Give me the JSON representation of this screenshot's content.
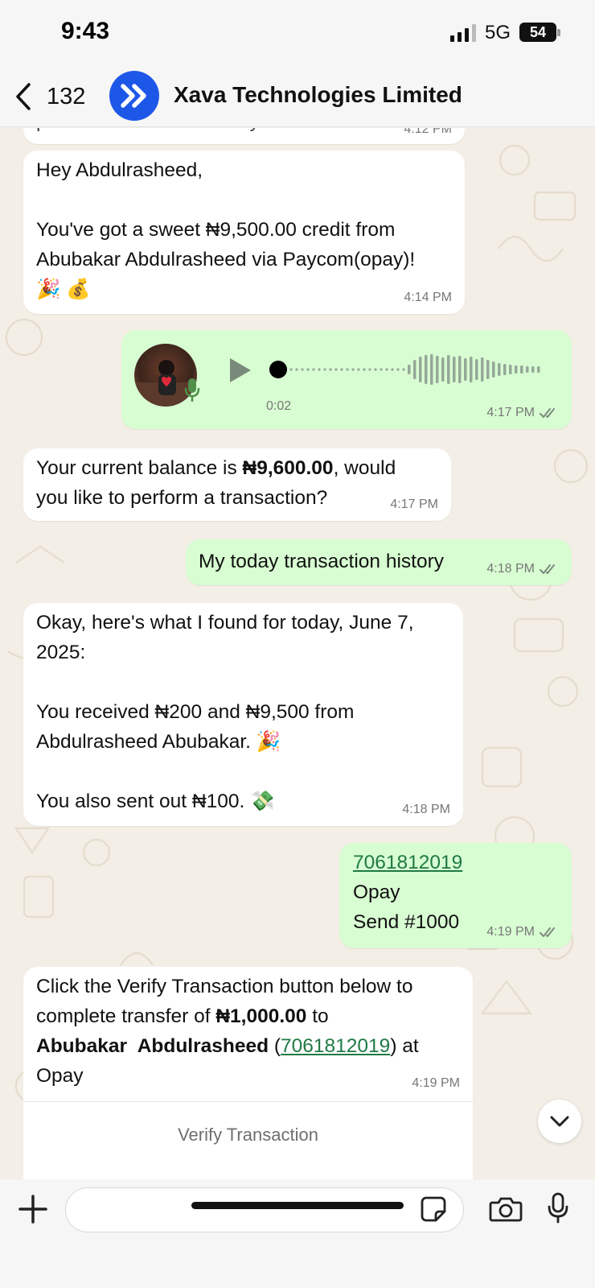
{
  "status_bar": {
    "time": "9:43",
    "network": "5G",
    "battery": "54"
  },
  "header": {
    "back_count": "132",
    "contact_name": "Xava Technologies Limited"
  },
  "messages": {
    "m0": {
      "text": "provider was successfully submitted",
      "time": "4:12 PM"
    },
    "m1": {
      "line1": "Hey Abdulrasheed,",
      "line2": "You've got a sweet ₦9,500.00 credit from",
      "line3": "Abubakar Abdulrasheed via Paycom(opay)!",
      "emoji": "🎉 💰",
      "time": "4:14 PM"
    },
    "m2": {
      "duration": "0:02",
      "time": "4:17 PM"
    },
    "m3": {
      "pre": "Your current balance is ",
      "amount": "₦9,600.00",
      "post": ", would",
      "line2": "you like to perform a transaction?",
      "time": "4:17 PM"
    },
    "m4": {
      "text": "My today transaction history",
      "time": "4:18 PM"
    },
    "m5": {
      "line1": "Okay, here's what I found for today, June 7,",
      "line2": "2025:",
      "line3": "You received ₦200 and ₦9,500 from",
      "line4": "Abdulrasheed Abubakar. 🎉",
      "line5": "You also sent out ₦100. 💸",
      "time": "4:18 PM"
    },
    "m6": {
      "phone": "7061812019",
      "line2": "Opay",
      "line3": "Send #1000",
      "time": "4:19 PM"
    },
    "m7": {
      "line1": "Click the Verify Transaction button below to",
      "pre2": "complete transfer of ",
      "amount": "₦1,000.00",
      "post2": " to",
      "name": "Abubakar  Abdulrasheed",
      "open": " (",
      "phone": "7061812019",
      "close": ") at",
      "line4": "Opay",
      "time": "4:19 PM",
      "button": "Verify Transaction"
    }
  },
  "colors": {
    "incoming_bubble": "#ffffff",
    "outgoing_bubble": "#d8fdd2",
    "link": "#1f7a44",
    "brand_blue": "#1d57e8",
    "tick": "#7b8a7b"
  },
  "composer": {
    "placeholder": ""
  }
}
